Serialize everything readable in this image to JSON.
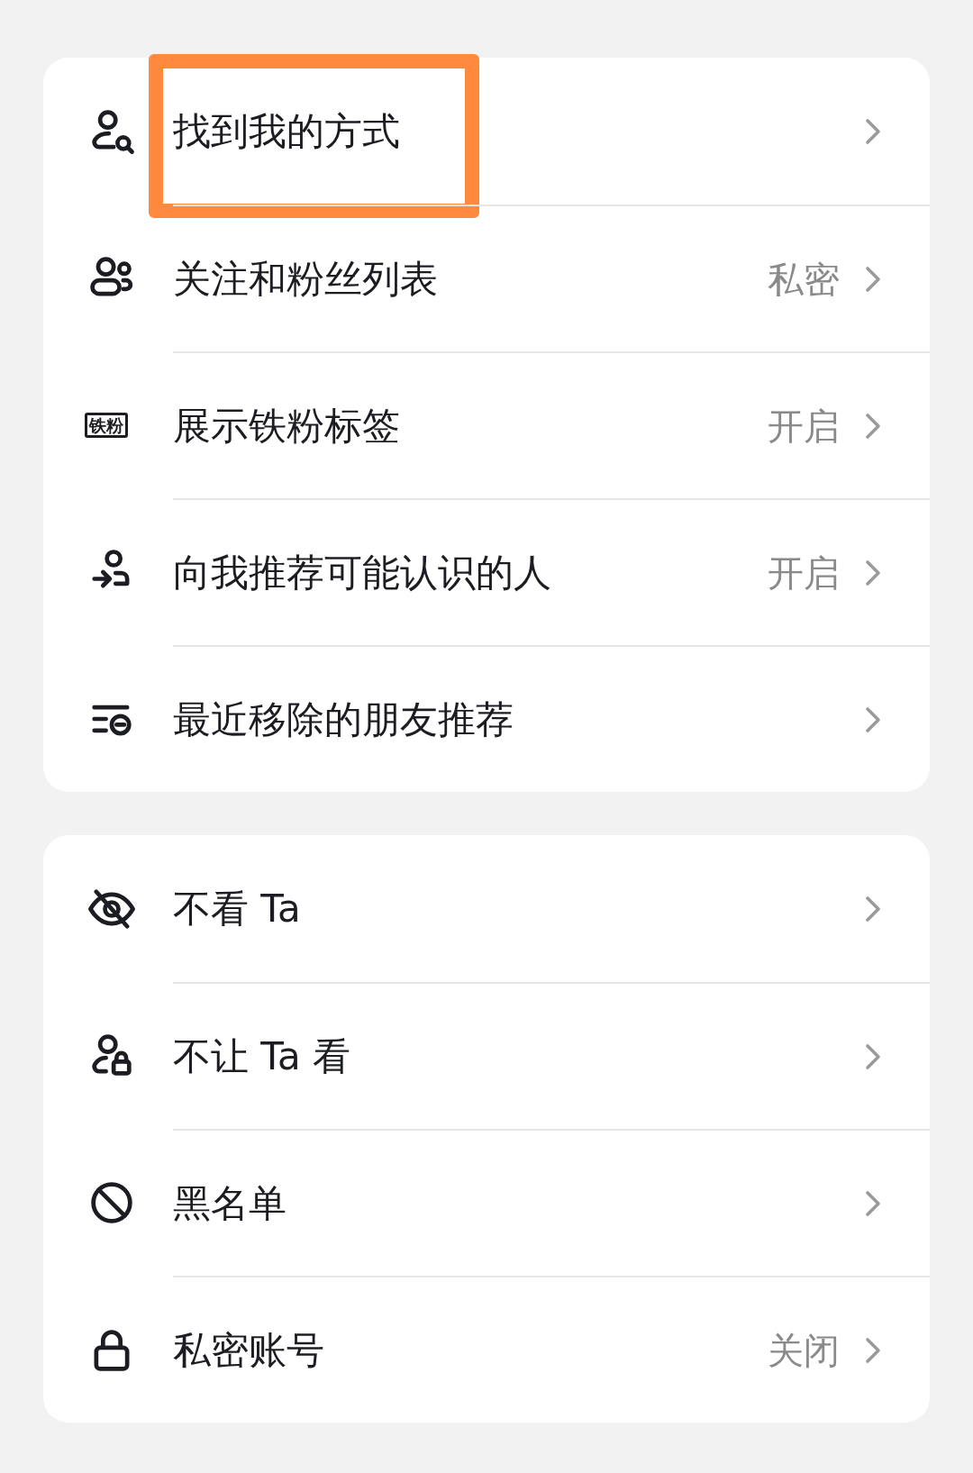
{
  "groups": [
    {
      "items": [
        {
          "kind": "person-search",
          "label": "找到我的方式",
          "highlighted": true
        },
        {
          "kind": "people",
          "label": "关注和粉丝列表",
          "value": "私密",
          "highlighted": false
        },
        {
          "kind": "badge",
          "badge_text": "铁粉",
          "label": "展示铁粉标签",
          "value": "开启",
          "highlighted": false
        },
        {
          "kind": "person-arrow",
          "label": "向我推荐可能认识的人",
          "value": "开启",
          "highlighted": false
        },
        {
          "kind": "list-remove",
          "label": "最近移除的朋友推荐",
          "highlighted": false
        }
      ]
    },
    {
      "items": [
        {
          "kind": "eye-off",
          "label": "不看 Ta",
          "highlighted": false
        },
        {
          "kind": "person-lock",
          "label": "不让 Ta 看",
          "highlighted": false
        },
        {
          "kind": "block",
          "label": "黑名单",
          "highlighted": false
        },
        {
          "kind": "lock",
          "label": "私密账号",
          "value": "关闭",
          "highlighted": false
        }
      ]
    }
  ]
}
